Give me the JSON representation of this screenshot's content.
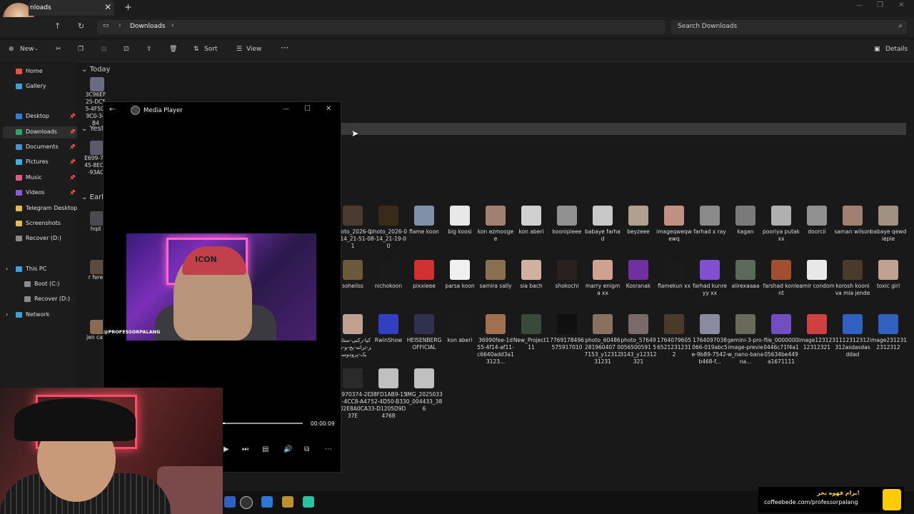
{
  "window": {
    "tab_title": "nloads",
    "tab_close": "✕",
    "new_tab": "+",
    "min": "—",
    "max": "❐",
    "close": "✕"
  },
  "address": {
    "crumb": "Downloads",
    "sep": "›",
    "search_placeholder": "Search Downloads"
  },
  "toolbar": {
    "new_label": "New",
    "sort_label": "Sort",
    "view_label": "View",
    "more_label": "···",
    "details_label": "Details"
  },
  "sidebar": {
    "items": [
      {
        "label": "Home",
        "color": "#e5533d",
        "pinned": false
      },
      {
        "label": "Gallery",
        "color": "#3aa0e0",
        "pinned": false
      },
      {
        "label": "Desktop",
        "color": "#2b7fd4",
        "pinned": true
      },
      {
        "label": "Downloads",
        "color": "#2fa36b",
        "pinned": true
      },
      {
        "label": "Documents",
        "color": "#4a8fd4",
        "pinned": true
      },
      {
        "label": "Pictures",
        "color": "#3ab0e0",
        "pinned": true
      },
      {
        "label": "Music",
        "color": "#e05a8a",
        "pinned": true
      },
      {
        "label": "Videos",
        "color": "#8a5ad4",
        "pinned": true
      },
      {
        "label": "Telegram Desktop",
        "color": "#e8b84a",
        "pinned": false
      },
      {
        "label": "Screenshots",
        "color": "#e8b84a",
        "pinned": false
      },
      {
        "label": "Recover (D:)",
        "color": "#8a8a8a",
        "pinned": false
      },
      {
        "label": "This PC",
        "color": "#3aa0e0",
        "pinned": false
      },
      {
        "label": "Boot (C:)",
        "color": "#8a8a8a",
        "pinned": false
      },
      {
        "label": "Recover (D:)",
        "color": "#8a8a8a",
        "pinned": false
      },
      {
        "label": "Network",
        "color": "#3aa0e0",
        "pinned": false
      }
    ]
  },
  "groups": {
    "today": "Today",
    "yesterday": "Yest",
    "earlier": "Earli"
  },
  "left_files": [
    {
      "label": "3C96EF25-DC55-4F50-9C0-34B4",
      "color": "#6a6a80"
    },
    {
      "label": "E699-7B45-8EC0-93AC",
      "color": "#5a5a6a"
    },
    {
      "label": "hqd",
      "color": "#4a4a50"
    },
    {
      "label": "r fere",
      "color": "#5a4a40"
    },
    {
      "label": "jen car",
      "color": "#8a6a50"
    }
  ],
  "files_row1": [
    {
      "label": "photo_2026-08-14_21-51-01",
      "color": "#4a3a30"
    },
    {
      "label": "photo_2026-08-14_21-19-00",
      "color": "#3a2a1a"
    },
    {
      "label": "flame koon",
      "color": "#8090a8"
    },
    {
      "label": "big koosi",
      "color": "#e8e8e8"
    },
    {
      "label": "kon ezmoogee",
      "color": "#a08070"
    },
    {
      "label": "kon aberi",
      "color": "#d0d0d0"
    },
    {
      "label": "koonipieee",
      "color": "#909090"
    },
    {
      "label": "babaye farhad",
      "color": "#c8c8c8"
    },
    {
      "label": "beyzeee",
      "color": "#b0a090"
    },
    {
      "label": "imageqweqwewq",
      "color": "#c09080"
    },
    {
      "label": "farhad x ray",
      "color": "#8a8a8a"
    },
    {
      "label": "kagan",
      "color": "#7a7a7a"
    },
    {
      "label": "pooriya putak xx",
      "color": "#b0b0b0"
    },
    {
      "label": "doorcii",
      "color": "#909090"
    },
    {
      "label": "saman wilson",
      "color": "#a08070"
    },
    {
      "label": "babaye qewdiepie",
      "color": "#a09080"
    }
  ],
  "files_row2": [
    {
      "label": "soheilss",
      "color": "#6a5a3a"
    },
    {
      "label": "nichokoon",
      "color": "#1a1a1a"
    },
    {
      "label": "pixxieee",
      "color": "#d03030"
    },
    {
      "label": "parsa koon",
      "color": "#f0f0f0"
    },
    {
      "label": "samira sally",
      "color": "#8a7050"
    },
    {
      "label": "sia bach",
      "color": "#d0b0a0"
    },
    {
      "label": "shokochi",
      "color": "#2a2020"
    },
    {
      "label": "marry enigma xx",
      "color": "#d0a090"
    },
    {
      "label": "Kosranak",
      "color": "#7030a0"
    },
    {
      "label": "flamekun xx",
      "color": "#1a1a1a"
    },
    {
      "label": "farhad kunreyy xx",
      "color": "#8050d0"
    },
    {
      "label": "alirexaaaa",
      "color": "#5a6a5a"
    },
    {
      "label": "farshad konlent",
      "color": "#a05030"
    },
    {
      "label": "amir condom",
      "color": "#e8e8e8"
    },
    {
      "label": "korosh kooni va mia jende",
      "color": "#4a3a2a"
    },
    {
      "label": "toxic girl",
      "color": "#c0a090"
    }
  ],
  "files_row3": [
    {
      "label": "کیا-رکنی-ستاریمز-ترانه-یخ-و-موزیک-پرودوسر",
      "color": "#c0a090"
    },
    {
      "label": "RwinShow",
      "color": "#3040c0"
    },
    {
      "label": "HEISENBERGOFFICIAL",
      "color": "#303050"
    },
    {
      "label": "kon aberi",
      "color": "#1a1a1a"
    },
    {
      "label": "36990fee-1d55-4f14-af11-c6640add3a13123...",
      "color": "#a07050"
    },
    {
      "label": "New_Project111",
      "color": "#3a4a3a"
    },
    {
      "label": "7769178496575917010",
      "color": "#101010"
    },
    {
      "label": "photo_60486281960407 07153_y1231231231",
      "color": "#8a7060"
    },
    {
      "label": "photo_57649056500591 53143_y12312321",
      "color": "#7a6a6a"
    },
    {
      "label": "17640796056521231231 2",
      "color": "#4a3a2a"
    },
    {
      "label": "1764097038066-019abc5e-9b89-7542-b468-f...",
      "color": "#8a8aa0"
    },
    {
      "label": "gemini-3-pro-image-preview_nano-banana...",
      "color": "#6a6a5a"
    },
    {
      "label": "file_00000000446c71f4a105634be449a1671111",
      "color": "#7050c0"
    },
    {
      "label": "image12312312312321",
      "color": "#d04040"
    },
    {
      "label": "1112312312312asdasdasddad",
      "color": "#3060c0"
    },
    {
      "label": "image2312312312312",
      "color": "#3060c0"
    }
  ],
  "files_row4": [
    {
      "label": "21970374-2EE2-4CC8-A47E-02E8A0CA337E",
      "color": "#2a2a2a"
    },
    {
      "label": "38FD1AB9-1552-4D50-B333-D1205D9D4768",
      "color": "#c0c0c0"
    },
    {
      "label": "IMG_20250330_004433_386",
      "color": "#c0c0c0"
    }
  ],
  "media_player": {
    "title": "Media Player",
    "back": "←",
    "min": "—",
    "max": "☐",
    "close": "✕",
    "watermark": "@PROFESSORPALANG",
    "cap_text": "ICON",
    "time": "00:00:09",
    "progress": 0.03
  },
  "banner": {
    "line1": "برام قهوه بخر!",
    "line2": "coffeebede.com/professorpalang"
  }
}
